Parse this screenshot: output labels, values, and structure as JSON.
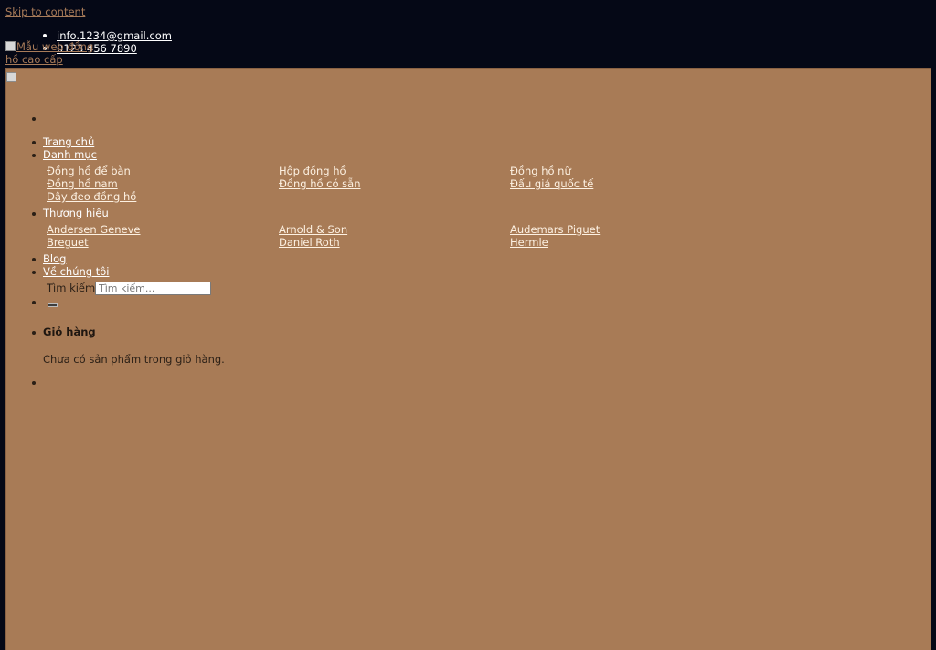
{
  "skip_link": "Skip to content",
  "contact": {
    "email": "info.1234@gmail.com",
    "phone": "0123 456 7890"
  },
  "logo_alt": "Mẫu web đồng hồ cao cấp",
  "nav": {
    "home": "Trang chủ",
    "categories": "Danh mục",
    "category_items": [
      "Đồng hồ để bàn",
      "Hộp đồng hồ",
      "Đồng hồ nữ",
      "Đồng hồ nam",
      "Đồng hồ có sẵn",
      "Đấu giá quốc tế",
      "Dây đeo đồng hồ"
    ],
    "brands": "Thương hiệu",
    "brand_items": [
      "Andersen Geneve",
      "Arnold & Son",
      "Audemars Piguet",
      "Breguet",
      "Daniel Roth",
      "Hermle"
    ],
    "blog": "Blog",
    "about": "Về chúng tôi"
  },
  "search": {
    "label": "Tìm kiếm:",
    "placeholder": "Tìm kiếm..."
  },
  "cart": {
    "title": "Giỏ hàng",
    "empty_message": "Chưa có sản phẩm trong giỏ hàng."
  },
  "colors": {
    "page_background": "#050816",
    "panel_background": "#a87b56",
    "link_accent": "#a87b59"
  }
}
